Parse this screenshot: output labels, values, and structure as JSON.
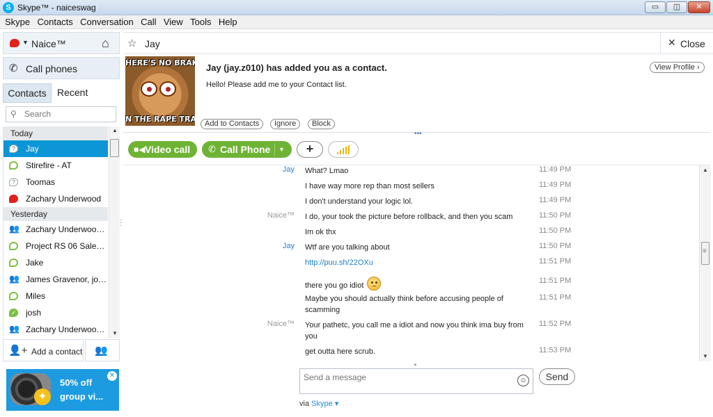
{
  "window": {
    "title": "Skype™ - naiceswag",
    "min": "▭",
    "max": "◫",
    "close": "✕"
  },
  "menu": [
    "Skype",
    "Contacts",
    "Conversation",
    "Call",
    "View",
    "Tools",
    "Help"
  ],
  "profile": {
    "name": "Naice™"
  },
  "call_phones": {
    "label": "Call phones"
  },
  "tabs": {
    "contacts": "Contacts",
    "recent": "Recent"
  },
  "search": {
    "placeholder": "Search"
  },
  "groups": {
    "today": "Today",
    "yesterday": "Yesterday"
  },
  "contacts_today": [
    {
      "name": "Jay",
      "status": "unknown",
      "selected": true
    },
    {
      "name": "Stirefire - AT",
      "status": "online"
    },
    {
      "name": "Toomas",
      "status": "unknown"
    },
    {
      "name": "Zachary Underwood",
      "status": "away"
    }
  ],
  "contacts_yesterday": [
    {
      "name": "Zachary Underwood,...",
      "status": "group"
    },
    {
      "name": "Project RS 06 Sales [...",
      "status": "online"
    },
    {
      "name": "Jake",
      "status": "online"
    },
    {
      "name": "James Gravenor, jos...",
      "status": "group"
    },
    {
      "name": "Miles",
      "status": "online"
    },
    {
      "name": "josh",
      "status": "ok"
    },
    {
      "name": "Zachary Underwood,...",
      "status": "group"
    }
  ],
  "left_footer": {
    "add_contact": "Add a contact"
  },
  "ad": {
    "text": "50% off group vi..."
  },
  "conversation": {
    "name": "Jay",
    "close_label": "Close"
  },
  "request": {
    "avatar_top": "HERE'S NO BRAKE",
    "avatar_bottom": "N THE RAPE TRAI",
    "headline": "Jay (jay.z010) has added you as a contact.",
    "message": "Hello! Please add me to your Contact list.",
    "add_to_contacts": "Add to Contacts",
    "ignore": "Ignore",
    "block": "Block",
    "view_profile": "View Profile"
  },
  "actions": {
    "video_call": "Video call",
    "call_phone": "Call Phone"
  },
  "messages": [
    {
      "who": "Jay",
      "text": "What? Lmao",
      "time": "11:49 PM"
    },
    {
      "who": "",
      "text": "I have way more rep than most sellers",
      "time": "11:49 PM"
    },
    {
      "who": "",
      "text": "I don't understand your logic lol.",
      "time": "11:49 PM"
    },
    {
      "who": "Naice™",
      "text": "I do, your took the picture before rollback, and then you scam",
      "time": "11:50 PM"
    },
    {
      "who": "",
      "text": "Im ok thx",
      "time": "11:50 PM"
    },
    {
      "who": "Jay",
      "text": "Wtf are you talking about",
      "time": "11:50 PM"
    },
    {
      "who": "",
      "text": "http://puu.sh/22OXu",
      "time": "11:51 PM"
    },
    {
      "who": "",
      "text": "there you go idiot",
      "time": "11:51 PM"
    },
    {
      "who": "",
      "text": "Maybe you should actually think before accusing people of scamming",
      "time": "11:51 PM"
    },
    {
      "who": "Naice™",
      "text": "Your pathetc, you call me a idiot and now you think ima buy from you",
      "time": "11:52 PM"
    },
    {
      "who": "",
      "text": "get outta here scrub.",
      "time": "11:53 PM"
    }
  ],
  "compose": {
    "placeholder": "Send a message",
    "send": "Send",
    "via": "via",
    "via_service": "Skype"
  },
  "colors": {
    "accent": "#0c96d7",
    "green": "#6fb335",
    "away": "#e0221b"
  }
}
